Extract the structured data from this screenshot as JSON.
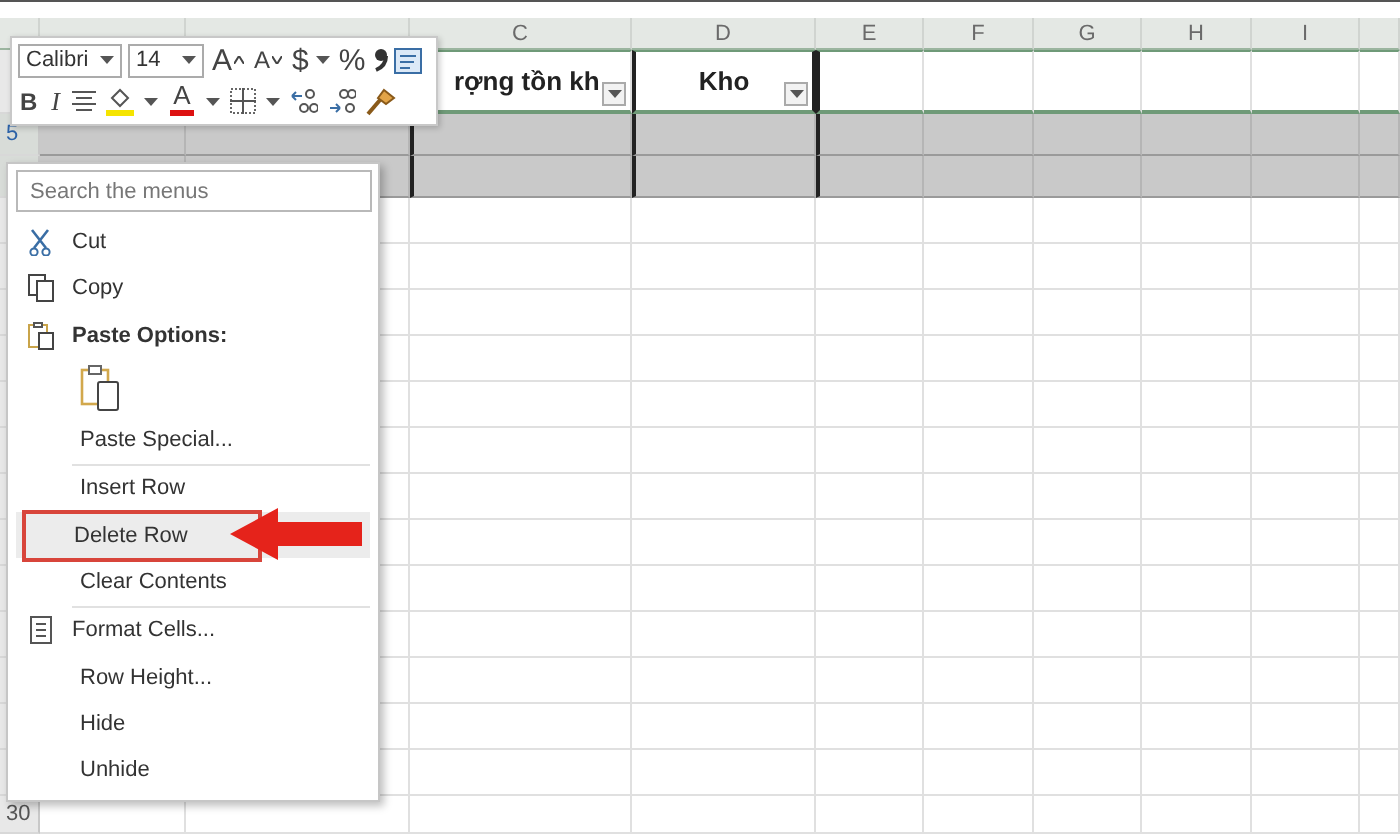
{
  "sheet": {
    "columns": [
      null,
      null,
      "C",
      "D",
      "E",
      "F",
      "G",
      "H",
      "I"
    ],
    "rows": [
      {
        "selected": false,
        "cells": [
          null,
          null,
          {
            "text": "rợng tồn kh",
            "filter": true
          },
          {
            "text": "Kho",
            "filter": true
          }
        ]
      },
      {
        "number": "5",
        "selected": true
      },
      {
        "selected": true
      },
      {
        "number": "30",
        "selected": false
      }
    ]
  },
  "mini_toolbar": {
    "font_name": "Calibri",
    "font_size": "14",
    "grow_font": "A",
    "shrink_font": "A",
    "currency": "$",
    "percent": "%",
    "bold": "B",
    "italic": "I",
    "font_color": "A"
  },
  "context_menu": {
    "search": {
      "placeholder": "Search the menus"
    },
    "items": [
      {
        "kind": "icon-command",
        "label": "Cut",
        "selected": false
      },
      {
        "kind": "icon-command",
        "label": "Copy",
        "selected": false
      },
      {
        "kind": "heading",
        "label": "Paste Options:"
      },
      {
        "kind": "paste-option"
      },
      {
        "kind": "command",
        "label": "Paste Special...",
        "selected": false
      },
      {
        "kind": "separator"
      },
      {
        "kind": "command",
        "label": "Insert Row",
        "selected": false
      },
      {
        "kind": "command",
        "label": "Delete Row",
        "selected": true
      },
      {
        "kind": "command",
        "label": "Clear Contents",
        "selected": false
      },
      {
        "kind": "separator"
      },
      {
        "kind": "icon-command",
        "label": "Format Cells...",
        "selected": false
      },
      {
        "kind": "command",
        "label": "Row Height...",
        "selected": false
      },
      {
        "kind": "command",
        "label": "Hide",
        "selected": false
      },
      {
        "kind": "command",
        "label": "Unhide",
        "selected": false
      }
    ]
  }
}
